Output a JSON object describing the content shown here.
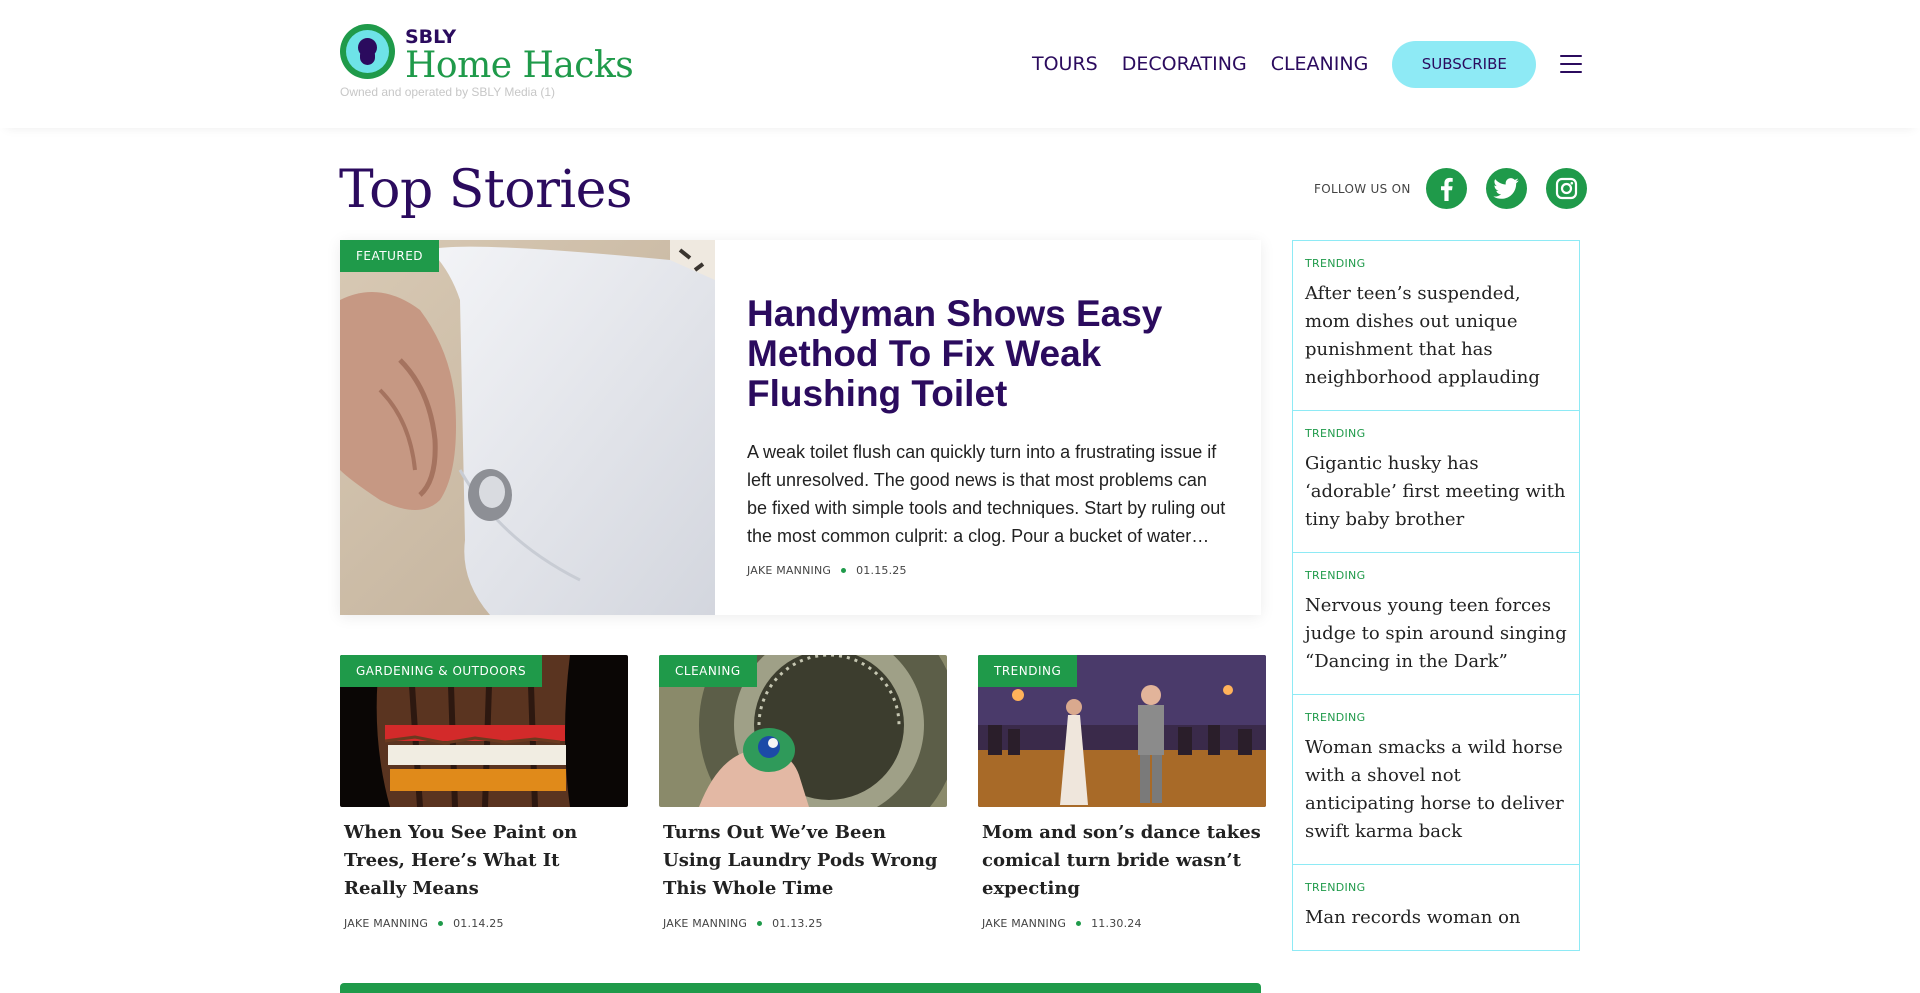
{
  "header": {
    "logo_brand": "SBLY",
    "logo_name": "Home Hacks",
    "tagline": "Owned and operated by SBLY Media (1)",
    "nav": [
      "TOURS",
      "DECORATING",
      "CLEANING"
    ],
    "subscribe_label": "SUBSCRIBE"
  },
  "page_title": "Top Stories",
  "follow_label": "FOLLOW US ON",
  "social": [
    "facebook-icon",
    "twitter-icon",
    "instagram-icon"
  ],
  "featured": {
    "badge": "FEATURED",
    "title": "Handyman Shows Easy Method To Fix Weak Flushing Toilet",
    "excerpt": "A weak toilet flush can quickly turn into a frustrating issue if left unresolved. The good news is that most problems can be fixed with simple tools and techniques. Start by ruling out the most common culprit: a clog. Pour a bucket of water…",
    "author": "JAKE MANNING",
    "date": "01.15.25"
  },
  "cards": [
    {
      "badge": "GARDENING & OUTDOORS",
      "title": "When You See Paint on Trees, Here’s What It Really Means",
      "author": "JAKE MANNING",
      "date": "01.14.25"
    },
    {
      "badge": "CLEANING",
      "title": "Turns Out We’ve Been Using Laundry Pods Wrong This Whole Time",
      "author": "JAKE MANNING",
      "date": "01.13.25"
    },
    {
      "badge": "TRENDING",
      "title": "Mom and son’s dance takes comical turn bride wasn’t expecting",
      "author": "JAKE MANNING",
      "date": "11.30.24"
    }
  ],
  "trending": [
    {
      "label": "TRENDING",
      "title": "After teen’s suspended, mom dishes out unique punishment that has neighborhood applauding"
    },
    {
      "label": "TRENDING",
      "title": "Gigantic husky has ‘adorable’ first meeting with tiny baby brother"
    },
    {
      "label": "TRENDING",
      "title": "Nervous young teen forces judge to spin around singing “Dancing in the Dark”"
    },
    {
      "label": "TRENDING",
      "title": "Woman smacks a wild horse with a shovel not anticipating horse to deliver swift karma back"
    },
    {
      "label": "TRENDING",
      "title": "Man records woman on"
    }
  ],
  "colors": {
    "brand_green": "#1f9a4a",
    "brand_purple": "#2b0b5e",
    "accent_cyan": "#8eeaf5"
  }
}
